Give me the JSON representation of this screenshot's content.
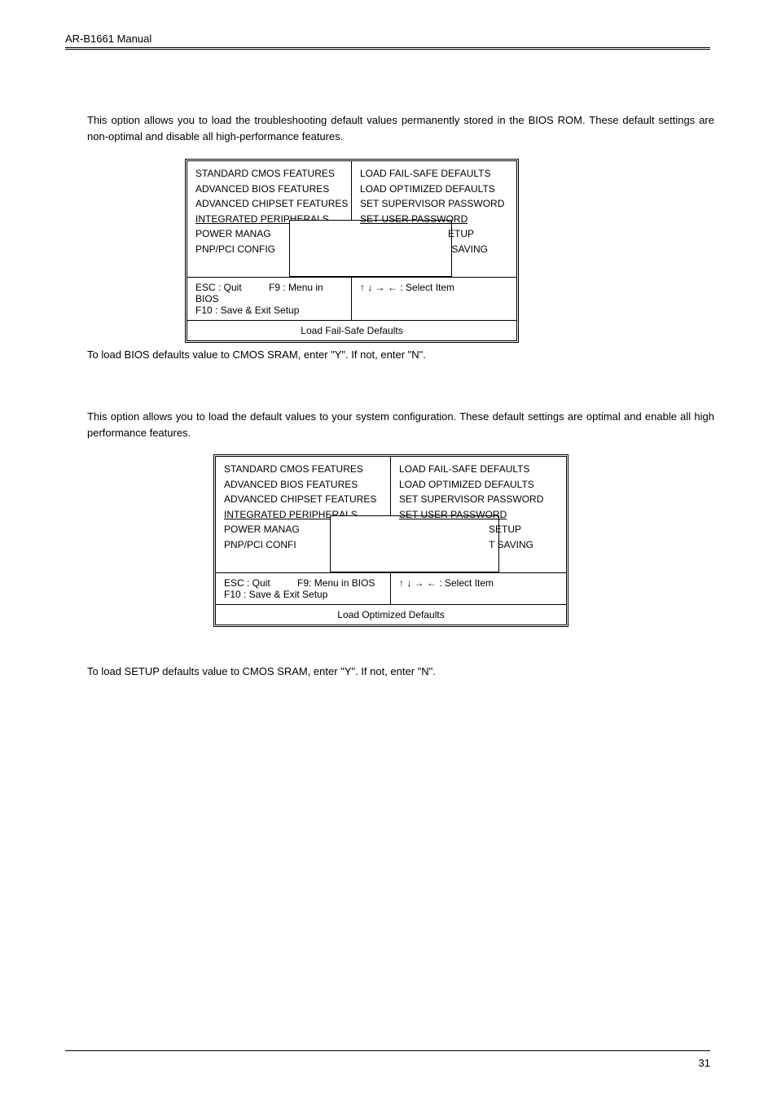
{
  "header": {
    "title": "AR-B1661 Manual"
  },
  "paragraphs": {
    "p1": "This option allows you to load the troubleshooting default values permanently stored in the BIOS ROM. These default settings are non-optimal and disable all high-performance features.",
    "p2": "To load BIOS defaults value to CMOS SRAM, enter \"Y\". If not, enter \"N\".",
    "p3": "This option allows you to load the default values to your system configuration. These default settings are optimal and enable all high performance features.",
    "p4": "To load SETUP defaults value to CMOS SRAM, enter \"Y\". If not, enter \"N\"."
  },
  "bios1": {
    "left": {
      "l1": "STANDARD CMOS FEATURES",
      "l2": "ADVANCED BIOS FEATURES",
      "l3": "ADVANCED CHIPSET FEATURES",
      "l4": "INTEGRATED PERIPHERALS",
      "l5": "POWER MANAG",
      "l6": "PNP/PCI CONFIG"
    },
    "right": {
      "r1": "LOAD FAIL-SAFE DEFAULTS",
      "r2": "LOAD OPTIMIZED DEFAULTS",
      "r3": "SET SUPERVISOR PASSWORD",
      "r4": "SET USER PASSWORD",
      "r5": "ETUP",
      "r6": "SAVING"
    },
    "bottom_left_a": "ESC : Quit",
    "bottom_left_b": "F9 : Menu in BIOS",
    "bottom_left2": "F10 : Save & Exit Setup",
    "bottom_right": "↑ ↓ → ← : Select Item",
    "last": "Load Fail-Safe Defaults"
  },
  "bios2": {
    "left": {
      "l1": "STANDARD CMOS FEATURES",
      "l2": "ADVANCED BIOS FEATURES",
      "l3": "ADVANCED CHIPSET FEATURES",
      "l4": "INTEGRATED PERIPHERALS",
      "l5": "POWER MANAG",
      "l6": "PNP/PCI CONFI"
    },
    "right": {
      "r1": "LOAD FAIL-SAFE DEFAULTS",
      "r2": "LOAD OPTIMIZED DEFAULTS",
      "r3": "SET SUPERVISOR PASSWORD",
      "r4": "SET USER PASSWORD",
      "r5": "SETUP",
      "r6": "T SAVING"
    },
    "bottom_left_a": "ESC : Quit",
    "bottom_left_b": "F9: Menu in BIOS",
    "bottom_left2": "F10 : Save & Exit Setup",
    "bottom_right": "↑ ↓ → ← : Select Item",
    "last": "Load Optimized Defaults"
  },
  "page_number": "31"
}
